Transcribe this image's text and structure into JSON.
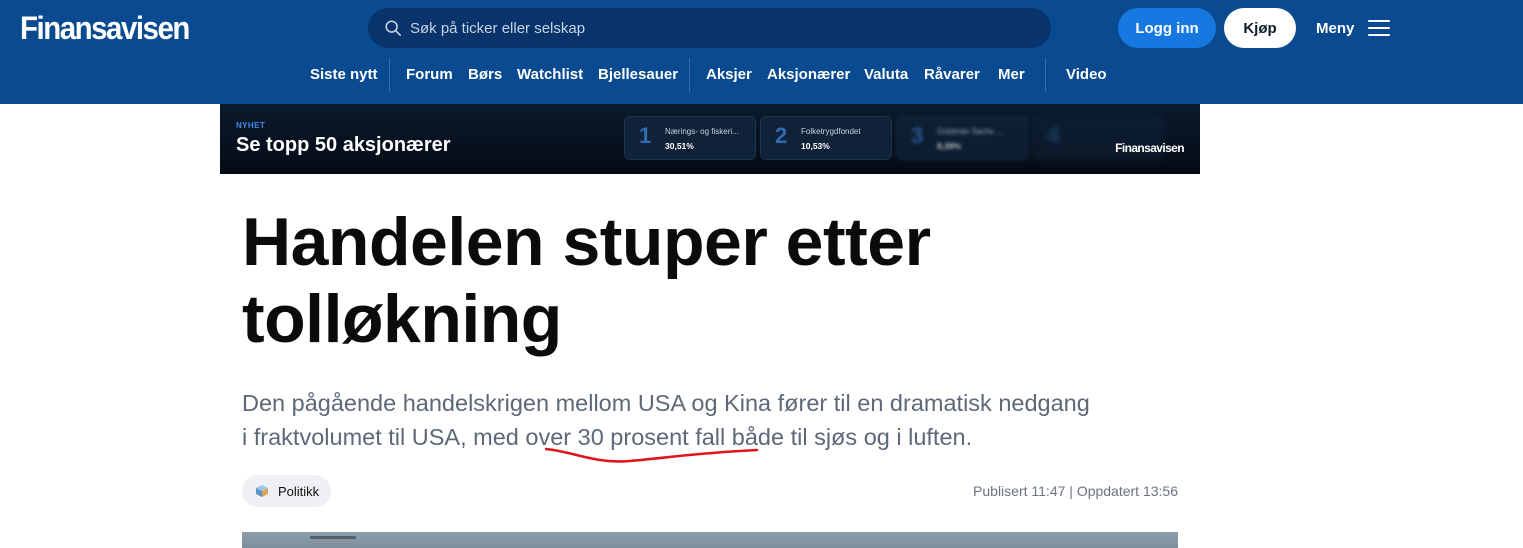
{
  "header": {
    "logo": "Finansavisen",
    "search_placeholder": "Søk på ticker eller selskap",
    "login_label": "Logg inn",
    "buy_label": "Kjøp",
    "menu_label": "Meny"
  },
  "nav": {
    "items": [
      "Siste nytt",
      "Forum",
      "Børs",
      "Watchlist",
      "Bjellesauer",
      "Aksjer",
      "Aksjonærer",
      "Valuta",
      "Råvarer",
      "Mer",
      "Video"
    ]
  },
  "banner": {
    "tag": "NYHET",
    "headline": "Se topp 50 aksjonærer",
    "brand": "Finansavisen",
    "cards": [
      {
        "rank": "1",
        "name": "Nærings- og fiskeri...",
        "pct": "30,51%"
      },
      {
        "rank": "2",
        "name": "Folketrygdfondet",
        "pct": "10,53%"
      },
      {
        "rank": "3",
        "name": "Goldman Sachs ...",
        "pct": "8,39%"
      },
      {
        "rank": "4",
        "name": "",
        "pct": ""
      }
    ]
  },
  "article": {
    "title_line1": "Handelen stuper etter",
    "title_line2": "tolløkning",
    "lead_line1": "Den pågående handelskrigen mellom USA og Kina fører til en dramatisk nedgang",
    "lead_line2": "i fraktvolumet til USA, med over 30 prosent fall både til sjøs og i luften.",
    "category": "Politikk",
    "published": "Publisert 11:47",
    "separator": "|",
    "updated": "Oppdatert 13:56"
  },
  "colors": {
    "header_bg": "#0a4a91",
    "accent_blue": "#1678e0",
    "annotation_red": "#e0141b"
  }
}
